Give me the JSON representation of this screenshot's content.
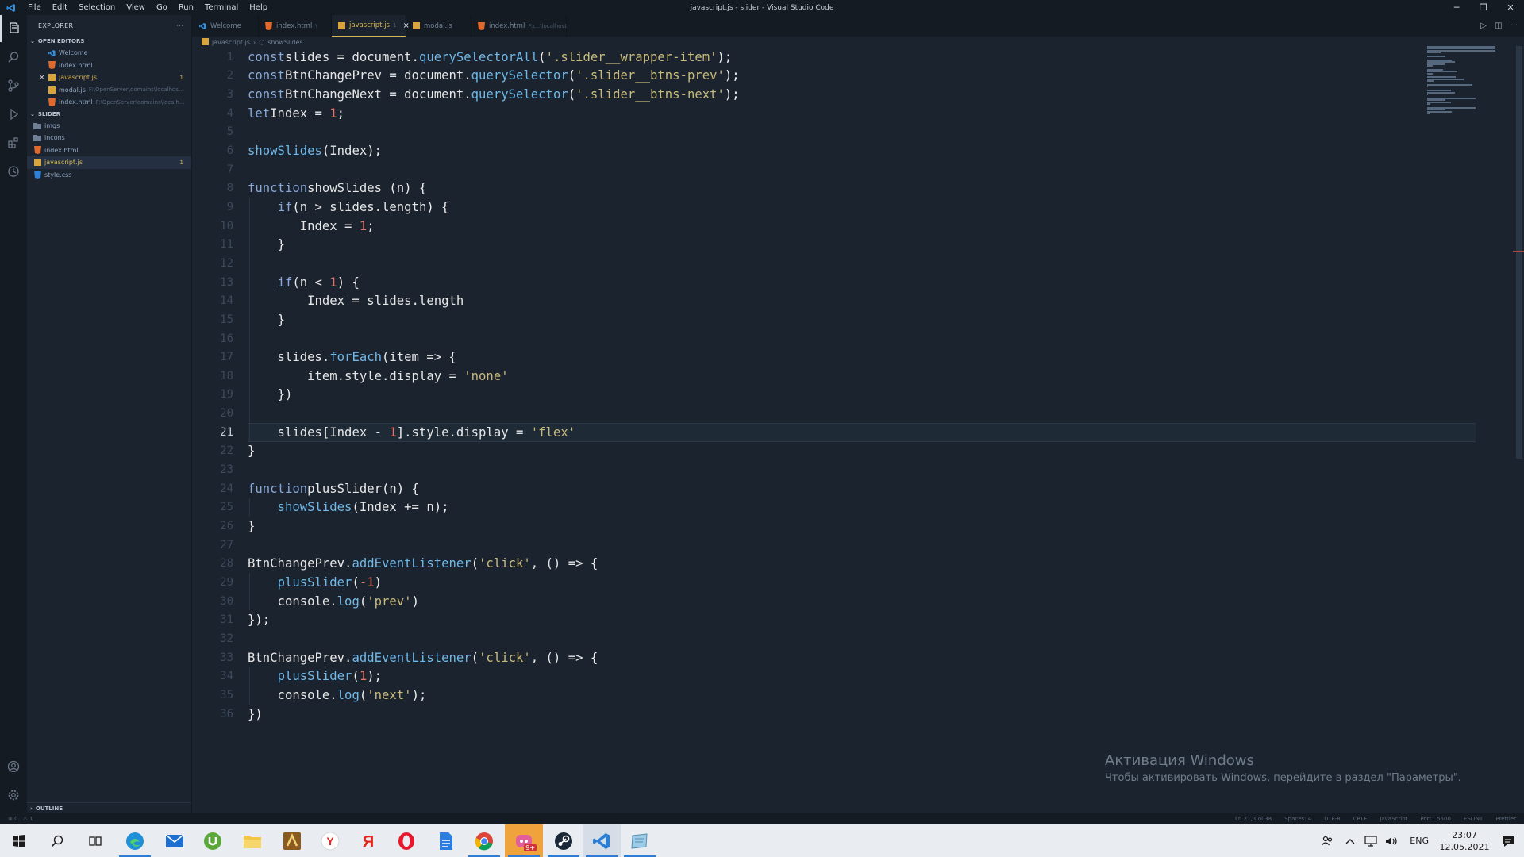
{
  "window": {
    "title": "javascript.js - slider - Visual Studio Code",
    "menu": [
      "File",
      "Edit",
      "Selection",
      "View",
      "Go",
      "Run",
      "Terminal",
      "Help"
    ]
  },
  "sidebar": {
    "header": "EXPLORER",
    "more": "···",
    "open_editors_label": "OPEN EDITORS",
    "open_editors": [
      {
        "name": "Welcome",
        "path": "",
        "badge": "",
        "icon": "vscode-icon"
      },
      {
        "name": "index.html",
        "path": "",
        "badge": "",
        "icon": "html-file-icon"
      },
      {
        "name": "javascript.js",
        "path": "",
        "badge": "1",
        "icon": "js-file-icon"
      },
      {
        "name": "modal.js",
        "path": "F:\\OpenServer\\domains\\localhos...",
        "badge": "",
        "icon": "js-file-icon"
      },
      {
        "name": "index.html",
        "path": "F:\\OpenServer\\domains\\localh...",
        "badge": "",
        "icon": "html-file-icon"
      }
    ],
    "folder_label": "SLIDER",
    "files": [
      {
        "name": "imgs",
        "badge": "",
        "icon": "folder-icon"
      },
      {
        "name": "incons",
        "badge": "",
        "icon": "folder-icon"
      },
      {
        "name": "index.html",
        "badge": "",
        "icon": "html-file-icon"
      },
      {
        "name": "javascript.js",
        "badge": "1",
        "icon": "js-file-icon"
      },
      {
        "name": "style.css",
        "badge": "",
        "icon": "css-file-icon"
      }
    ],
    "outline_label": "OUTLINE"
  },
  "tabs": [
    {
      "label": "Welcome",
      "path": "",
      "icon": "vscode-icon"
    },
    {
      "label": "index.html",
      "path": "\\",
      "icon": "html-file-icon"
    },
    {
      "label": "javascript.js",
      "path": "1",
      "icon": "js-file-icon"
    },
    {
      "label": "modal.js",
      "path": "",
      "icon": "js-file-icon"
    },
    {
      "label": "index.html",
      "path": "F:\\...\\localhost",
      "icon": "html-file-icon"
    }
  ],
  "breadcrumb": {
    "file": "javascript.js",
    "symbol": "showSlides"
  },
  "editor": {
    "current_line": 21,
    "lines": [
      [
        [
          "kw",
          "const"
        ],
        [
          "",
          "slides = document."
        ],
        [
          "fn",
          "querySelectorAll"
        ],
        [
          "punc",
          "("
        ],
        [
          "str",
          "'.slider__wrapper-item'"
        ],
        [
          "punc",
          ");"
        ]
      ],
      [
        [
          "kw",
          "const"
        ],
        [
          "",
          "BtnChangePrev = document."
        ],
        [
          "fn",
          "querySelector"
        ],
        [
          "punc",
          "("
        ],
        [
          "str",
          "'.slider__btns-prev'"
        ],
        [
          "punc",
          ");"
        ]
      ],
      [
        [
          "kw",
          "const"
        ],
        [
          "",
          "BtnChangeNext = document."
        ],
        [
          "fn",
          "querySelector"
        ],
        [
          "punc",
          "("
        ],
        [
          "str",
          "'.slider__btns-next'"
        ],
        [
          "punc",
          ");"
        ]
      ],
      [
        [
          "kw",
          "let"
        ],
        [
          "",
          "Index = "
        ],
        [
          "num",
          "1"
        ],
        [
          "punc",
          ";"
        ]
      ],
      [],
      [
        [
          "fn",
          "showSlides"
        ],
        [
          "punc",
          "("
        ],
        [
          "",
          "Index"
        ],
        [
          "punc",
          ");"
        ]
      ],
      [],
      [
        [
          "kw",
          "function"
        ],
        [
          "",
          "showSlides "
        ],
        [
          "punc",
          "(n) {"
        ]
      ],
      [
        [
          "",
          "    "
        ],
        [
          "kw",
          "if"
        ],
        [
          "punc",
          "("
        ],
        [
          "",
          "n > slides.length"
        ],
        [
          "punc",
          ") {"
        ]
      ],
      [
        [
          "",
          "       Index = "
        ],
        [
          "num",
          "1"
        ],
        [
          "punc",
          ";"
        ]
      ],
      [
        [
          "",
          "    "
        ],
        [
          "punc",
          "}"
        ]
      ],
      [],
      [
        [
          "",
          "    "
        ],
        [
          "kw",
          "if"
        ],
        [
          "",
          "(n < "
        ],
        [
          "num",
          "1"
        ],
        [
          "punc",
          ") {"
        ]
      ],
      [
        [
          "",
          "        Index = slides.length"
        ]
      ],
      [
        [
          "",
          "    "
        ],
        [
          "punc",
          "}"
        ]
      ],
      [],
      [
        [
          "",
          "    slides."
        ],
        [
          "fn",
          "forEach"
        ],
        [
          "punc",
          "("
        ],
        [
          "",
          "item => "
        ],
        [
          "punc",
          "{"
        ]
      ],
      [
        [
          "",
          "        item.style.display = "
        ],
        [
          "str",
          "'none'"
        ]
      ],
      [
        [
          "",
          "    "
        ],
        [
          "punc",
          "})"
        ]
      ],
      [],
      [
        [
          "",
          "    slides"
        ],
        [
          "punc",
          "["
        ],
        [
          "",
          "Index - "
        ],
        [
          "num",
          "1"
        ],
        [
          "punc",
          "]"
        ],
        [
          "",
          ".style.display = "
        ],
        [
          "str",
          "'flex'"
        ]
      ],
      [
        [
          "punc",
          "}"
        ]
      ],
      [],
      [
        [
          "kw",
          "function"
        ],
        [
          "",
          "plusSlider"
        ],
        [
          "punc",
          "("
        ],
        [
          "",
          "n"
        ],
        [
          "punc",
          ") {"
        ]
      ],
      [
        [
          "",
          "    "
        ],
        [
          "fn",
          "showSlides"
        ],
        [
          "punc",
          "("
        ],
        [
          "",
          "Index += n"
        ],
        [
          "punc",
          ");"
        ]
      ],
      [
        [
          "punc",
          "}"
        ]
      ],
      [],
      [
        [
          "",
          "BtnChangePrev."
        ],
        [
          "fn",
          "addEventListener"
        ],
        [
          "punc",
          "("
        ],
        [
          "str",
          "'click'"
        ],
        [
          "",
          ", () => "
        ],
        [
          "punc",
          "{"
        ]
      ],
      [
        [
          "",
          "    "
        ],
        [
          "fn",
          "plusSlider"
        ],
        [
          "punc",
          "("
        ],
        [
          "num",
          "-1"
        ],
        [
          "punc",
          ")"
        ]
      ],
      [
        [
          "",
          "    console."
        ],
        [
          "fn",
          "log"
        ],
        [
          "punc",
          "("
        ],
        [
          "str",
          "'prev'"
        ],
        [
          "punc",
          ")"
        ]
      ],
      [
        [
          "punc",
          "});"
        ]
      ],
      [],
      [
        [
          "",
          "BtnChangePrev."
        ],
        [
          "fn",
          "addEventListener"
        ],
        [
          "punc",
          "("
        ],
        [
          "str",
          "'click'"
        ],
        [
          "",
          ", () => "
        ],
        [
          "punc",
          "{"
        ]
      ],
      [
        [
          "",
          "    "
        ],
        [
          "fn",
          "plusSlider"
        ],
        [
          "punc",
          "("
        ],
        [
          "num",
          "1"
        ],
        [
          "punc",
          ");"
        ]
      ],
      [
        [
          "",
          "    console."
        ],
        [
          "fn",
          "log"
        ],
        [
          "punc",
          "("
        ],
        [
          "str",
          "'next'"
        ],
        [
          "punc",
          ");"
        ]
      ],
      [
        [
          "punc",
          "})"
        ]
      ]
    ]
  },
  "watermark": {
    "title": "Активация Windows",
    "subtitle": "Чтобы активировать Windows, перейдите в раздел \"Параметры\"."
  },
  "statusbar": {
    "left": [
      "⊗ 0",
      "⚠ 1"
    ],
    "right": [
      "Ln 21, Col 38",
      "Spaces: 4",
      "UTF-8",
      "CRLF",
      "JavaScript",
      "Port : 5500",
      "ESLINT",
      "Prettier"
    ]
  },
  "taskbar": {
    "language": "ENG",
    "time": "23:07",
    "date": "12.05.2021",
    "badge": "9+"
  },
  "colors": {
    "accent": "#d9b84e",
    "keyword": "#8aa8d8",
    "function": "#6fb8e8",
    "string": "#c9bb7d",
    "number": "#e8736b"
  }
}
